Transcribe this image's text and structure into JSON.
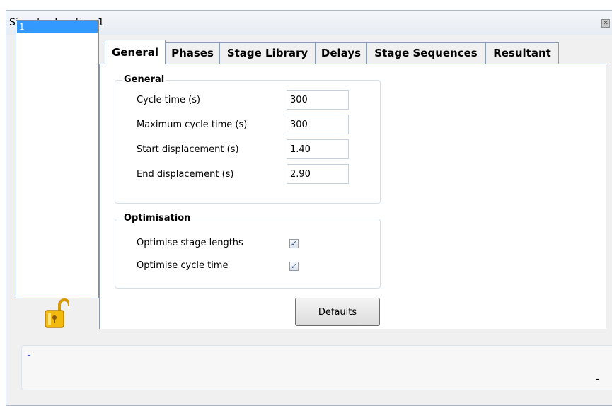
{
  "window": {
    "title": "Signals - Junction 1"
  },
  "junction_list": {
    "items": [
      {
        "label": "1",
        "selected": true
      }
    ]
  },
  "tabs": [
    {
      "label": "General",
      "active": true
    },
    {
      "label": "Phases",
      "active": false
    },
    {
      "label": "Stage Library",
      "active": false
    },
    {
      "label": "Delays",
      "active": false
    },
    {
      "label": "Stage Sequences",
      "active": false
    },
    {
      "label": "Resultant",
      "active": false
    }
  ],
  "general_group": {
    "title": "General",
    "fields": [
      {
        "label": "Cycle time (s)",
        "value": "300"
      },
      {
        "label": "Maximum cycle time (s)",
        "value": "300"
      },
      {
        "label": "Start displacement (s)",
        "value": "1.40"
      },
      {
        "label": "End displacement (s)",
        "value": "2.90"
      }
    ]
  },
  "optimisation_group": {
    "title": "Optimisation",
    "options": [
      {
        "label": "Optimise stage lengths",
        "checked": true
      },
      {
        "label": "Optimise cycle time",
        "checked": true
      }
    ]
  },
  "defaults_button": {
    "label": "Defaults"
  },
  "status": {
    "left_text": "-",
    "right_text": "-"
  },
  "colors": {
    "selection": "#3399ff",
    "accent": "#2a6fd0",
    "lock": "#f2b90f"
  }
}
